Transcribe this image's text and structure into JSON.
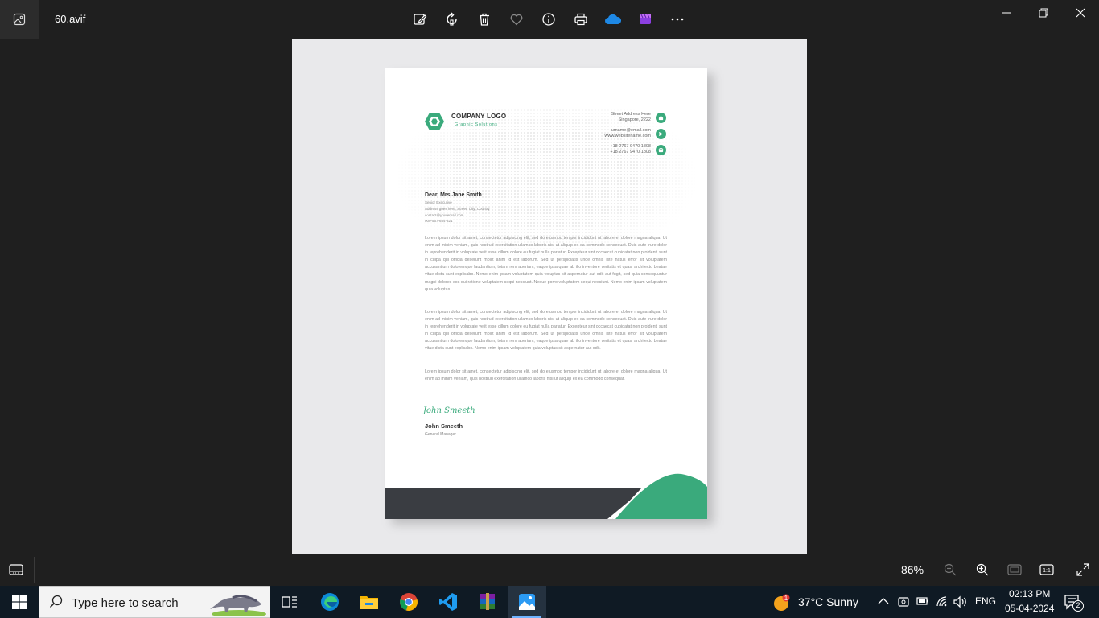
{
  "titlebar": {
    "filename": "60.avif",
    "toolbar": [
      "edit-image-icon",
      "rotate-icon",
      "delete-icon",
      "favorite-icon",
      "info-icon",
      "print-icon",
      "onedrive-icon",
      "clipchamp-icon",
      "more-icon"
    ]
  },
  "letterhead": {
    "company": "COMPANY LOGO",
    "tagline": "Graphic Solutions",
    "address_1": "Street Address Here",
    "address_2": "Singapore, 2222",
    "email": "urname@email.com",
    "website": "www.websitename.com",
    "phone_1": "+18 2767 9470 1808",
    "phone_2": "+18 2767 9470 1808",
    "recipient": {
      "name": "Dear, Mrs Jane Smith",
      "title": "Senior Executive",
      "address": "Address goes here, Street, City, Country",
      "email": "contact@youremail.com",
      "phone": "000-567-654-321"
    },
    "paragraph_1": "Lorem ipsum dolor sit amet, consectetur adipiscing elit, sed do eiusmod tempor incididunt ut labore et dolore magna aliqua. Ut enim ad minim veniam, quis nostrud exercitation ullamco laboris nisi ut aliquip ex ea commodo consequat. Duis aute irure dolor in reprehenderit in voluptate velit esse cillum dolore eu fugiat nulla pariatur. Excepteur sint occaecat cupidatat non proident, sunt in culpa qui officia deserunt mollit anim id est laborum. Sed ut perspiciatis unde omnis iste natus error sit voluptatem accusantium doloremque laudantium, totam rem aperiam, eaque ipsa quae ab illo inventore veritatis et quasi architecto beatae vitae dicta sunt explicabo. Nemo enim ipsam voluptatem quia voluptas sit aspernatur aut odit aut fugit, sed quia consequuntur magni dolores eos qui ratione voluptatem sequi nesciunt. Neque porro voluptatem sequi nesciunt. Nemo enim ipsam voluptatem quia voluptas.",
    "paragraph_2": "Lorem ipsum dolor sit amet, consectetur adipiscing elit, sed do eiusmod tempor incididunt ut labore et dolore magna aliqua. Ut enim ad minim veniam, quis nostrud exercitation ullamco laboris nisi ut aliquip ex ea commodo consequat. Duis aute irure dolor in reprehenderit in voluptate velit esse cillum dolore eu fugiat nulla pariatur. Excepteur sint occaecat cupidatat non proident, sunt in culpa qui officia deserunt mollit anim id est laborum. Sed ut perspiciatis unde omnis iste natus error sit voluptatem accusantium doloremque laudantium, totam rem aperiam, eaque ipsa quae ab illo inventore veritatis et quasi architecto beatae vitae dicta sunt explicabo. Nemo enim ipsam voluptatem quia voluptas sit aspernatur aut odit.",
    "paragraph_3": "Lorem ipsum dolor sit amet, consectetur adipiscing elit, sed do eiusmod tempor incididunt ut labore et dolore magna aliqua. Ut enim ad minim veniam, quis nostrud exercitation ullamco laboris nisi ut aliquip ex ea commodo consequat.",
    "signature": "John Smeeth",
    "signer_name": "John Smeeth",
    "signer_title": "General Manager",
    "accent_color": "#3aaa7c",
    "dark_color": "#3a3d42"
  },
  "bottombar": {
    "zoom": "86%"
  },
  "taskbar": {
    "search_placeholder": "Type here to search",
    "weather_badge": "1",
    "weather": "37°C  Sunny",
    "language": "ENG",
    "time": "02:13 PM",
    "date": "05-04-2024",
    "notifications": "2",
    "apps": [
      "task-view-icon",
      "edge-icon",
      "file-explorer-icon",
      "chrome-icon",
      "vscode-icon",
      "winrar-icon",
      "photos-icon"
    ]
  }
}
